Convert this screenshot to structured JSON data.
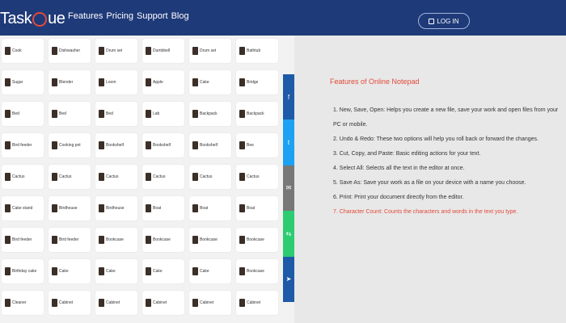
{
  "header": {
    "logo_pre": "Task",
    "logo_post": "ue",
    "nav": [
      "Features",
      "Pricing",
      "Support",
      "Blog"
    ],
    "login_label": "LOG IN"
  },
  "grid": {
    "rows": [
      [
        "Cook",
        "Dishwasher",
        "Drum set",
        "Dumbbell",
        "Drum set",
        "Bathtub"
      ],
      [
        "Sugar",
        "Blender",
        "Loom",
        "Apple",
        "Cake",
        "Bridge"
      ],
      [
        "Bed",
        "Bed",
        "Bed",
        "Lab",
        "Backpack",
        "Backpack"
      ],
      [
        "Bird feeder",
        "Cooking pot",
        "Bookshelf",
        "Bookshelf",
        "Bookshelf",
        "Bee"
      ],
      [
        "Cactus",
        "Cactus",
        "Cactus",
        "Cactus",
        "Cactus",
        "Cactus"
      ],
      [
        "Cake stand",
        "Birdhouse",
        "Birdhouse",
        "Boat",
        "Boat",
        "Boat"
      ],
      [
        "Bird feeder",
        "Bird feeder",
        "Bookcase",
        "Bookcase",
        "Bookcase",
        "Bookcase"
      ],
      [
        "Birthday cake",
        "Cake",
        "Cake",
        "Cake",
        "Cake",
        "Bookcase"
      ],
      [
        "Cleaner",
        "Cabinet",
        "Cabinet",
        "Cabinet",
        "Cabinet",
        "Cabinet"
      ]
    ]
  },
  "share": {
    "colors": [
      "#1e5aa8",
      "#1da1f2",
      "#777777",
      "#2ecc71",
      "#1e5aa8"
    ],
    "icons": [
      "f",
      "t",
      "mail-icon",
      "share-icon",
      "send-icon"
    ]
  },
  "content": {
    "title": "Features of Online Notepad",
    "items": [
      "1. New, Save, Open: Helps you create a new file, save your work and open files from your PC or mobile.",
      "2. Undo & Redo: These two options will help you roll back or forward the changes.",
      "3. Cut, Copy, and Paste: Basic editing actions for your text.",
      "4. Select All: Selects all the text in the editor at once.",
      "5. Save As: Save your work as a file on your device with a name you choose.",
      "6. Print: Print your document directly from the editor.",
      "7. Character Count: Counts the characters and words in the text you type."
    ]
  }
}
